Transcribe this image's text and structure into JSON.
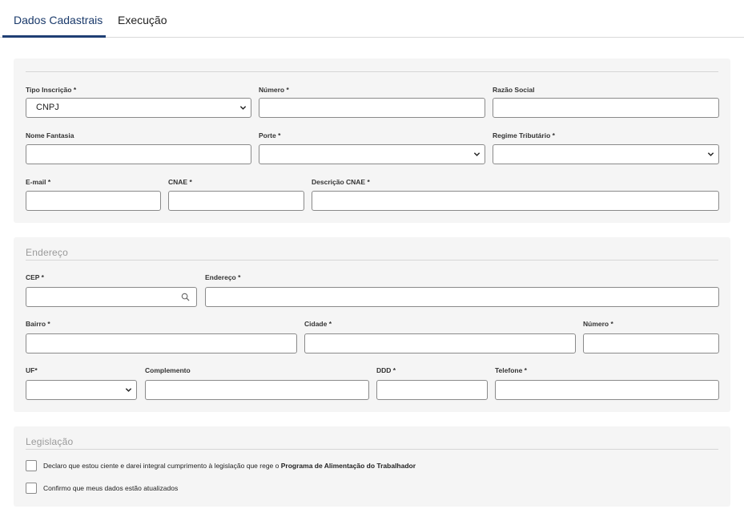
{
  "tabs": [
    {
      "label": "Dados Cadastrais",
      "active": true
    },
    {
      "label": "Execução",
      "active": false
    }
  ],
  "dados": {
    "tipo_inscricao": {
      "label": "Tipo Inscrição *",
      "value": "CNPJ"
    },
    "numero": {
      "label": "Número *",
      "value": ""
    },
    "razao_social": {
      "label": "Razão Social",
      "value": ""
    },
    "nome_fantasia": {
      "label": "Nome Fantasia",
      "value": ""
    },
    "porte": {
      "label": "Porte *",
      "value": ""
    },
    "regime_tributario": {
      "label": "Regime Tributário *",
      "value": ""
    },
    "email": {
      "label": "E-mail *",
      "value": ""
    },
    "cnae": {
      "label": "CNAE *",
      "value": ""
    },
    "descricao_cnae": {
      "label": "Descrição CNAE *",
      "value": ""
    }
  },
  "endereco": {
    "title": "Endereço",
    "cep": {
      "label": "CEP *",
      "value": ""
    },
    "endereco": {
      "label": "Endereço *",
      "value": ""
    },
    "bairro": {
      "label": "Bairro *",
      "value": ""
    },
    "cidade": {
      "label": "Cidade *",
      "value": ""
    },
    "numero": {
      "label": "Número *",
      "value": ""
    },
    "uf": {
      "label": "UF*",
      "value": ""
    },
    "complemento": {
      "label": "Complemento",
      "value": ""
    },
    "ddd": {
      "label": "DDD *",
      "value": ""
    },
    "telefone": {
      "label": "Telefone *",
      "value": ""
    }
  },
  "legislacao": {
    "title": "Legislação",
    "declaro_prefix": "Declaro que estou ciente e darei integral cumprimento à legislação que rege o ",
    "declaro_bold": "Programa de Alimentação do Trabalhador",
    "confirmo": "Confirmo que meus dados estão atualizados"
  },
  "icons": {
    "select": "chevron-down-icon",
    "cep_search": "search-icon"
  }
}
